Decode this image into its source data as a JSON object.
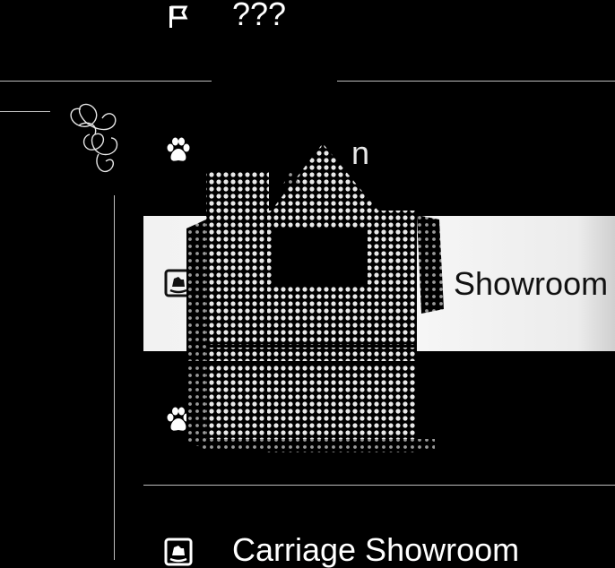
{
  "menu": {
    "items": [
      {
        "icon": "flag-icon",
        "label": "???",
        "state": "normal"
      },
      {
        "icon": "paw-icon",
        "label": "",
        "state": "obscured"
      },
      {
        "icon": "rocking-horse-icon",
        "label": "Showroom",
        "state": "selected"
      },
      {
        "icon": "paw-icon",
        "label": "",
        "state": "obscured"
      },
      {
        "icon": "rocking-horse-icon",
        "label": "Carriage Showroom",
        "state": "normal"
      }
    ]
  },
  "overlay": {
    "sprite": "haunted-house-sprite",
    "flourish": "swirl-ornament",
    "peek_glyph": "n"
  },
  "colors": {
    "background": "#000000",
    "text": "#ffffff",
    "selected_bg": "#f2f2f2",
    "selected_text": "#111111",
    "divider": "#bdbdbd"
  }
}
